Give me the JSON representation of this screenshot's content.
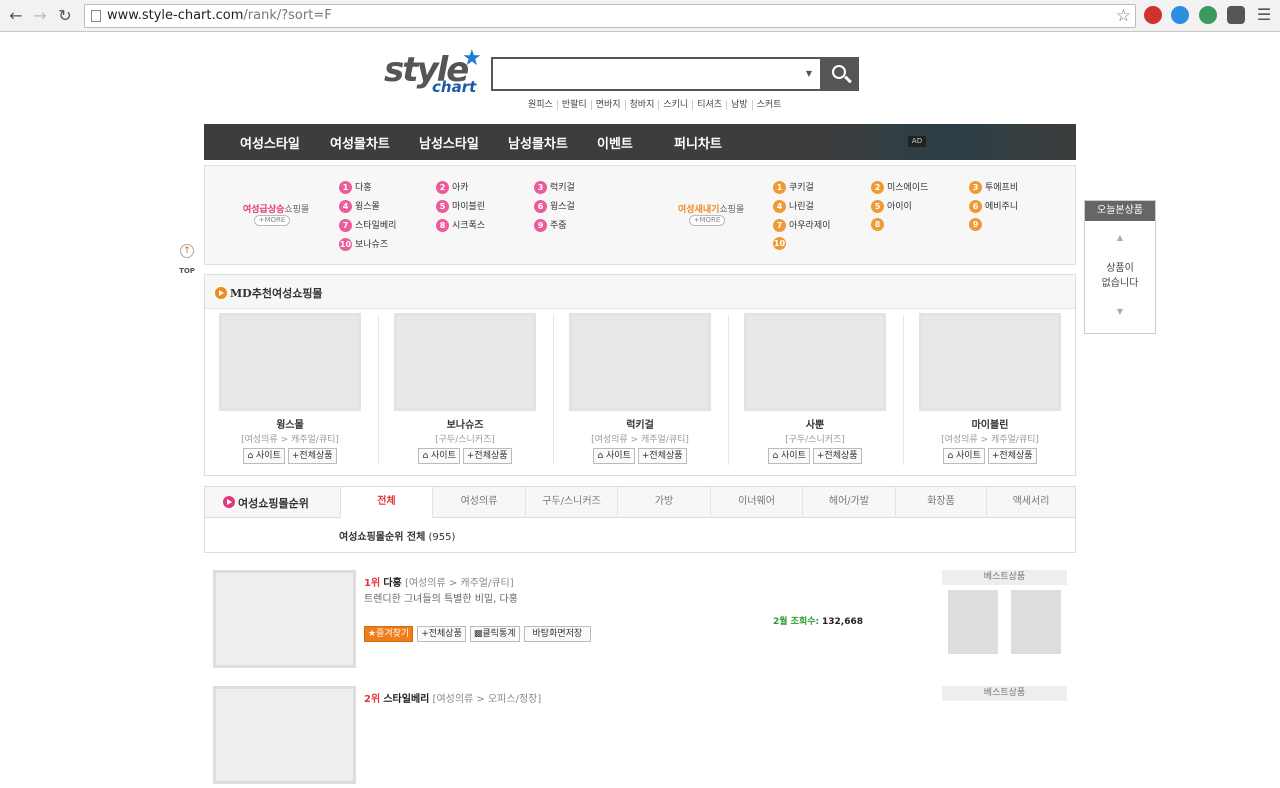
{
  "browser": {
    "url_host": "www.style-chart.com",
    "url_path": "/rank/?sort=F"
  },
  "logo": {
    "word1": "style",
    "word2": "chart"
  },
  "search": {
    "keywords": [
      "원피스",
      "반팔티",
      "면바지",
      "청바지",
      "스키니",
      "티셔츠",
      "남방",
      "스커트"
    ]
  },
  "nav": {
    "items": [
      "여성스타일",
      "여성몰차트",
      "남성스타일",
      "남성몰차트",
      "이벤트",
      "퍼니차트"
    ],
    "ad": "AD"
  },
  "rising": {
    "left": {
      "label_hl": "여성급상승",
      "label_rest": "쇼핑몰",
      "more": "+MORE",
      "entries": [
        {
          "n": "1",
          "name": "다홍"
        },
        {
          "n": "2",
          "name": "아카"
        },
        {
          "n": "3",
          "name": "럭키걸"
        },
        {
          "n": "4",
          "name": "윙스몰"
        },
        {
          "n": "5",
          "name": "마이블린"
        },
        {
          "n": "6",
          "name": "윙스걸"
        },
        {
          "n": "7",
          "name": "스타일베리"
        },
        {
          "n": "8",
          "name": "시크폭스"
        },
        {
          "n": "9",
          "name": "주줌"
        },
        {
          "n": "10",
          "name": "보나슈즈"
        }
      ]
    },
    "right": {
      "label_hl": "여성새내기",
      "label_rest": "쇼핑몰",
      "more": "+MORE",
      "entries": [
        {
          "n": "1",
          "name": "쿠키걸"
        },
        {
          "n": "2",
          "name": "미스에이드"
        },
        {
          "n": "3",
          "name": "투에프비"
        },
        {
          "n": "4",
          "name": "나린걸"
        },
        {
          "n": "5",
          "name": "아이이"
        },
        {
          "n": "6",
          "name": "에비주니"
        },
        {
          "n": "7",
          "name": "아우라제이"
        },
        {
          "n": "8",
          "name": ""
        },
        {
          "n": "9",
          "name": ""
        },
        {
          "n": "10",
          "name": ""
        }
      ]
    }
  },
  "top_button": {
    "label": "TOP"
  },
  "recent": {
    "title": "오늘본상품",
    "empty_line1": "상품이",
    "empty_line2": "없습니다"
  },
  "md": {
    "title": "MD추천여성쇼핑몰",
    "cards": [
      {
        "name": "윙스몰",
        "category": "[여성의류 > 캐주얼/큐티]",
        "site": "사이트",
        "all": "전체상품"
      },
      {
        "name": "보나슈즈",
        "category": "[구두/스니커즈]",
        "site": "사이트",
        "all": "전체상품"
      },
      {
        "name": "럭키걸",
        "category": "[여성의류 > 캐주얼/큐티]",
        "site": "사이트",
        "all": "전체상품"
      },
      {
        "name": "사뿐",
        "category": "[구두/스니커즈]",
        "site": "사이트",
        "all": "전체상품"
      },
      {
        "name": "마이블린",
        "category": "[여성의류 > 캐주얼/큐티]",
        "site": "사이트",
        "all": "전체상품"
      }
    ]
  },
  "ranking": {
    "title": "여성쇼핑몰순위",
    "tabs": [
      "전체",
      "여성의류",
      "구두/스니커즈",
      "가방",
      "이너웨어",
      "헤어/가발",
      "화장품",
      "액세서리"
    ],
    "summary_label": "여성쇼핑몰순위 전체",
    "summary_count": "(955)",
    "rows": [
      {
        "rank": "1위",
        "name": "다홍",
        "category": "[여성의류 > 캐주얼/큐티]",
        "desc": "트렌디한 그녀들의 특별한 비밀, 다홍",
        "btn_fav": "★즐겨찾기",
        "btn_all": "+전체상품",
        "btn_stats": "클릭통계",
        "btn_desktop": "바탕화면저장",
        "views_label": "2월 조회수:",
        "views_value": "132,668",
        "best_title": "베스트상품"
      },
      {
        "rank": "2위",
        "name": "스타일베리",
        "category": "[여성의류 > 오피스/정장]",
        "best_title": "베스트상품"
      }
    ]
  }
}
